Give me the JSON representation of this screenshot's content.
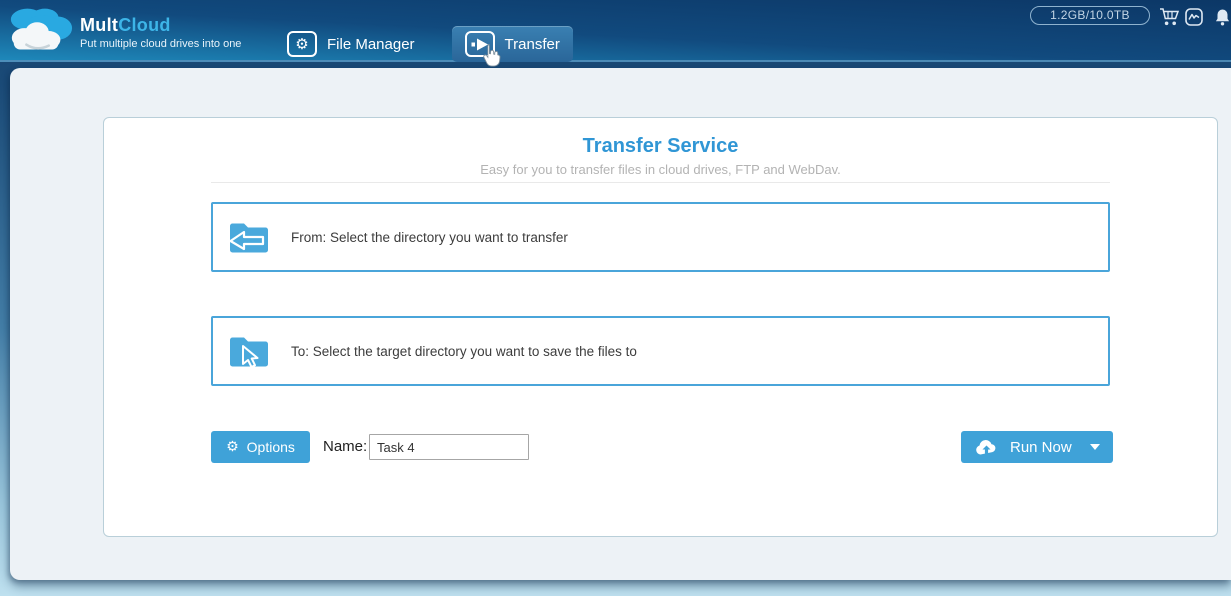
{
  "header": {
    "brand": {
      "part1": "Mult",
      "part2": "Cloud",
      "tagline": "Put multiple cloud drives into one"
    },
    "nav": [
      {
        "label": "File Manager"
      },
      {
        "label": "Transfer"
      }
    ],
    "storage_quota": "1.2GB/10.0TB"
  },
  "main": {
    "title": "Transfer Service",
    "subtitle": "Easy for you to transfer files in cloud drives, FTP and WebDav.",
    "from_box_label": "From: Select the directory you want to transfer",
    "to_box_label": "To: Select the target directory you want to save the files to",
    "options_button_label": "Options",
    "name_label": "Name:",
    "task_name_value": "Task 4",
    "run_now_label": "Run Now"
  },
  "icons": {
    "gear": "⚙"
  },
  "colors": {
    "accent_blue": "#3fa2d8",
    "title_blue": "#3096d5",
    "box_border_blue": "#4aa5da",
    "header_dark": "#0c3766",
    "header_light": "#1e88ba",
    "panel_bg": "#edf2f6",
    "logo_cloud_blue": "#29a9e1"
  }
}
